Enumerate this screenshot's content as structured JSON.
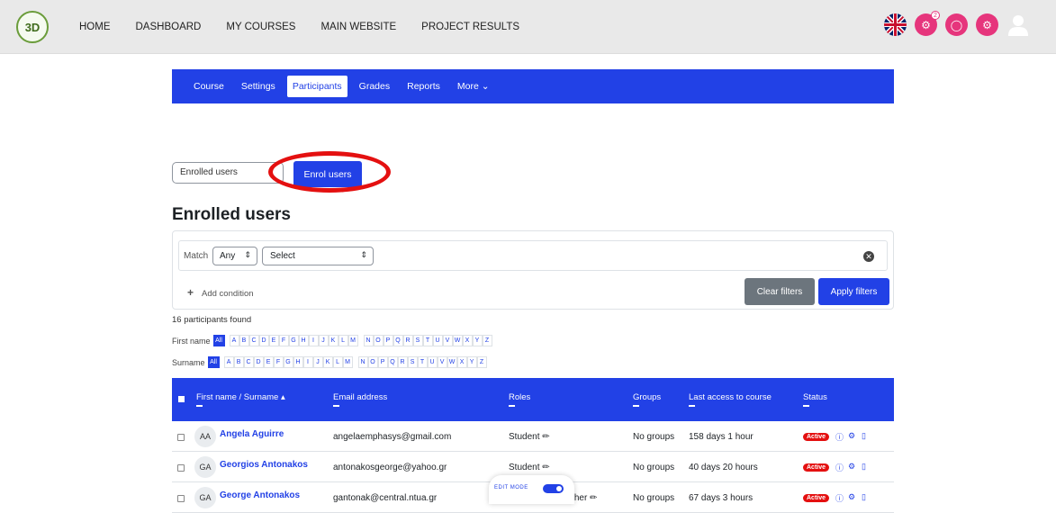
{
  "logo": {
    "text": "3D"
  },
  "nav": {
    "items": [
      "HOME",
      "DASHBOARD",
      "MY COURSES",
      "MAIN WEBSITE",
      "PROJECT RESULTS"
    ]
  },
  "notification_count": "2",
  "course_nav": {
    "tabs": [
      "Course",
      "Settings",
      "Participants",
      "Grades",
      "Reports",
      "More ⌄"
    ],
    "active": "Participants"
  },
  "enrol": {
    "select_value": "Enrolled users",
    "button": "Enrol users"
  },
  "heading": "Enrolled users",
  "filter": {
    "match_label": "Match",
    "match_value": "Any",
    "select_value": "Select",
    "add_condition": "Add condition",
    "clear": "Clear filters",
    "apply": "Apply filters"
  },
  "found": "16 participants found",
  "first_name_label": "First name",
  "surname_label": "Surname",
  "all_label": "All",
  "letters1": [
    "A",
    "B",
    "C",
    "D",
    "E",
    "F",
    "G",
    "H",
    "I",
    "J",
    "K",
    "L",
    "M"
  ],
  "letters2": [
    "N",
    "O",
    "P",
    "Q",
    "R",
    "S",
    "T",
    "U",
    "V",
    "W",
    "X",
    "Y",
    "Z"
  ],
  "table": {
    "headers": [
      "First name / Surname ▴",
      "Email address",
      "Roles",
      "Groups",
      "Last access to course",
      "Status"
    ],
    "rows": [
      {
        "initials": "AA",
        "name": "Angela Aguirre",
        "email": "angelaemphasys@gmail.com",
        "role": "Student ✏",
        "groups": "No groups",
        "access": "158 days 1 hour",
        "status": "Active"
      },
      {
        "initials": "GA",
        "name": "Georgios Antonakos",
        "email": "antonakosgeorge@yahoo.gr",
        "role": "Student ✏",
        "groups": "No groups",
        "access": "40 days 20 hours",
        "status": "Active"
      },
      {
        "initials": "GA",
        "name": "George Antonakos",
        "email": "gantonak@central.ntua.gr",
        "role": "Non-editing teacher ✏",
        "groups": "No groups",
        "access": "67 days 3 hours",
        "status": "Active"
      }
    ]
  },
  "edit_mode": "EDIT MODE",
  "colors": {
    "primary": "#2241e6",
    "accent": "#e6357c",
    "highlight": "#e41010"
  }
}
